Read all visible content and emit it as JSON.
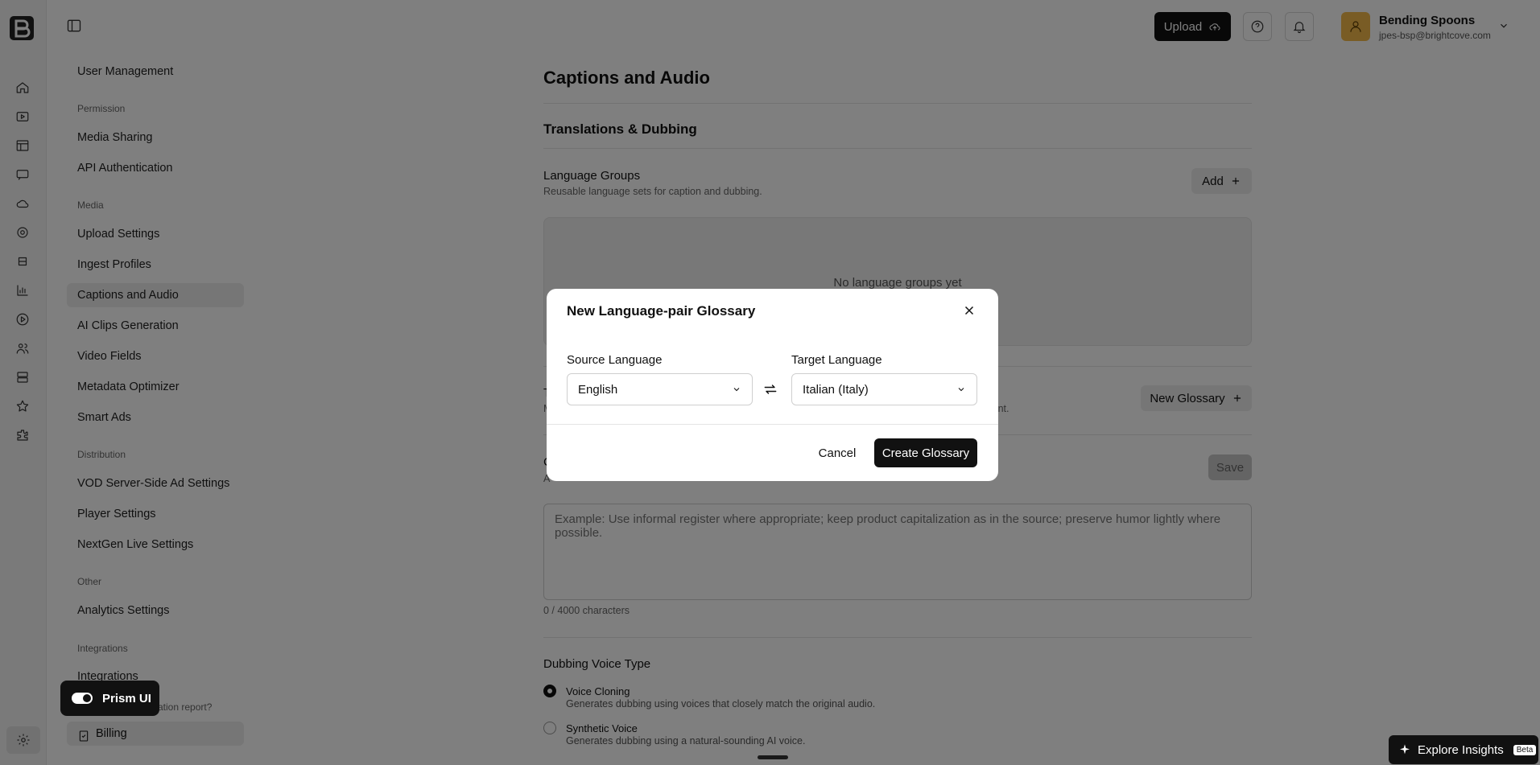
{
  "topbar": {
    "upload_label": "Upload",
    "account_name": "Bending Spoons",
    "account_email": "jpes-bsp@brightcove.com"
  },
  "nav": {
    "items": [
      {
        "label": "User Management"
      },
      {
        "heading": "Permission"
      },
      {
        "label": "Media Sharing"
      },
      {
        "label": "API Authentication"
      },
      {
        "heading": "Media"
      },
      {
        "label": "Upload Settings"
      },
      {
        "label": "Ingest Profiles"
      },
      {
        "label": "Captions and Audio"
      },
      {
        "label": "AI Clips Generation"
      },
      {
        "label": "Video Fields"
      },
      {
        "label": "Metadata Optimizer"
      },
      {
        "label": "Smart Ads"
      },
      {
        "heading": "Distribution"
      },
      {
        "label": "VOD Server-Side Ad Settings"
      },
      {
        "label": "Player Settings"
      },
      {
        "label": "NextGen Live Settings"
      },
      {
        "heading": "Other"
      },
      {
        "label": "Analytics Settings"
      },
      {
        "heading": "Integrations"
      },
      {
        "label": "Integrations"
      }
    ],
    "util_text": "zation report?",
    "billing_label": "Billing"
  },
  "main": {
    "page_title": "Captions and Audio",
    "section_title": "Translations & Dubbing",
    "language_groups": {
      "title": "Language Groups",
      "subtitle": "Reusable language sets for caption and dubbing.",
      "add_label": "Add",
      "empty_text": "No language groups yet"
    },
    "glossary": {
      "title": "T",
      "subtitle": "M",
      "subtitle_right": "onsistent.",
      "new_label": "New Glossary"
    },
    "instructions": {
      "title": "C",
      "subtitle": "A",
      "save_label": "Save",
      "placeholder": "Example: Use informal register where appropriate; keep product capitalization as in the source; preserve humor lightly where possible.",
      "char_count": "0 / 4000 characters"
    },
    "dubbing": {
      "title": "Dubbing Voice Type",
      "options": [
        {
          "label": "Voice Cloning",
          "desc": "Generates dubbing using voices that closely match the original audio.",
          "selected": true
        },
        {
          "label": "Synthetic Voice",
          "desc": "Generates dubbing using a natural-sounding AI voice.",
          "selected": false
        }
      ]
    }
  },
  "modal": {
    "title": "New Language-pair Glossary",
    "source_label": "Source Language",
    "source_value": "English",
    "target_label": "Target Language",
    "target_value": "Italian (Italy)",
    "cancel_label": "Cancel",
    "create_label": "Create Glossary"
  },
  "floating": {
    "prism_label": "Prism UI",
    "insights_label": "Explore Insights",
    "beta_label": "Beta"
  }
}
